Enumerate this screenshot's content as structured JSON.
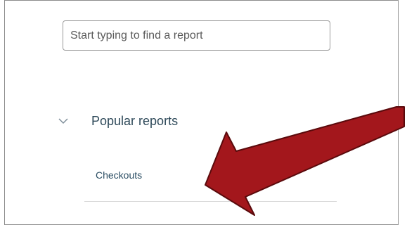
{
  "search": {
    "placeholder": "Start typing to find a report",
    "value": ""
  },
  "sections": [
    {
      "title": "Popular reports",
      "expanded": true,
      "items": [
        {
          "label": "Checkouts"
        }
      ]
    }
  ],
  "icons": {
    "chevron": "chevron-down-icon",
    "annotation": "red-arrow"
  },
  "colors": {
    "arrow_fill": "#a3171c",
    "arrow_stroke": "#5a0a0c",
    "link_text": "#2a4d63"
  }
}
